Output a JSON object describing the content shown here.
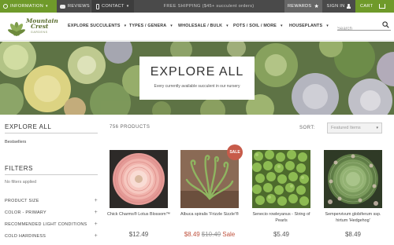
{
  "topbar": {
    "information": "INFORMATION",
    "reviews": "REVIEWS",
    "contact": "CONTACT",
    "shipping": "FREE SHIPPING ($45+ succulent orders)",
    "rewards": "REWARDS",
    "signin": "SIGN IN",
    "cart": "CART"
  },
  "logo": {
    "line1": "Mountain",
    "line2": "Crest",
    "sub": "GARDENS"
  },
  "nav": [
    {
      "label": "EXPLORE SUCCULENTS"
    },
    {
      "label": "TYPES / GENERA"
    },
    {
      "label": "WHOLESALE / BULK"
    },
    {
      "label": "POTS / SOIL / MORE"
    },
    {
      "label": "HOUSEPLANTS"
    }
  ],
  "search": {
    "placeholder": "Search"
  },
  "hero": {
    "title": "EXPLORE ALL",
    "subtitle": "Every currently available succulent in our nursery"
  },
  "sidebar": {
    "explore_heading": "EXPLORE ALL",
    "bestsellers": "Bestsellers",
    "filters_heading": "FILTERS",
    "no_filters": "No filters applied",
    "filters": [
      {
        "label": "PRODUCT SIZE"
      },
      {
        "label": "COLOR - PRIMARY"
      },
      {
        "label": "RECOMMENDED LIGHT CONDITIONS"
      },
      {
        "label": "COLD HARDINESS"
      }
    ]
  },
  "listing": {
    "count": "756 PRODUCTS",
    "sort_label": "SORT:",
    "sort_value": "Featured Items"
  },
  "products": [
    {
      "name": "Chick Charms® Lotus Blossom™",
      "price": "$12.49"
    },
    {
      "name": "Albuca spiralis 'Frizzle Sizzle'®",
      "price_sale": "$8.49",
      "price_old": "$10.49",
      "sale_word": "Sale",
      "badge": "SALE"
    },
    {
      "name": "Senecio rowleyanus - String of Pearls",
      "price": "$5.49"
    },
    {
      "name": "Sempervivum globiferum ssp. hirtum 'Hedgehog'",
      "price": "$8.49"
    }
  ],
  "colors": {
    "accent_green": "#6f9a2a",
    "topbar": "#4a4a4a",
    "sale": "#c75b4a"
  }
}
